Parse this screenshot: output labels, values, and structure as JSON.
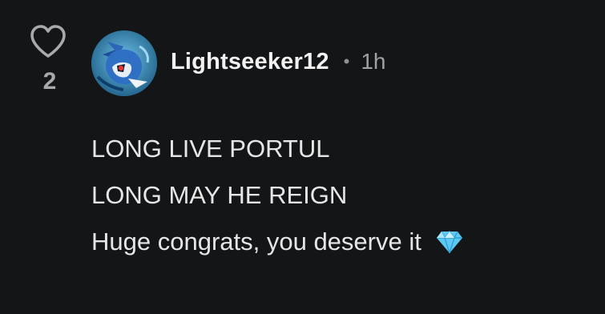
{
  "comment": {
    "likes": "2",
    "username": "Lightseeker12",
    "separator": "•",
    "time": "1h",
    "lines": [
      "LONG LIVE PORTUL",
      "LONG MAY HE REIGN",
      "Huge congrats, you deserve it"
    ],
    "emoji": "gem-emoji"
  },
  "colors": {
    "background": "#141517",
    "text": "#e6e6e7",
    "muted": "#a0a1a4",
    "heart_outline": "#a8a9ab",
    "gem": "#5ec8f2"
  }
}
